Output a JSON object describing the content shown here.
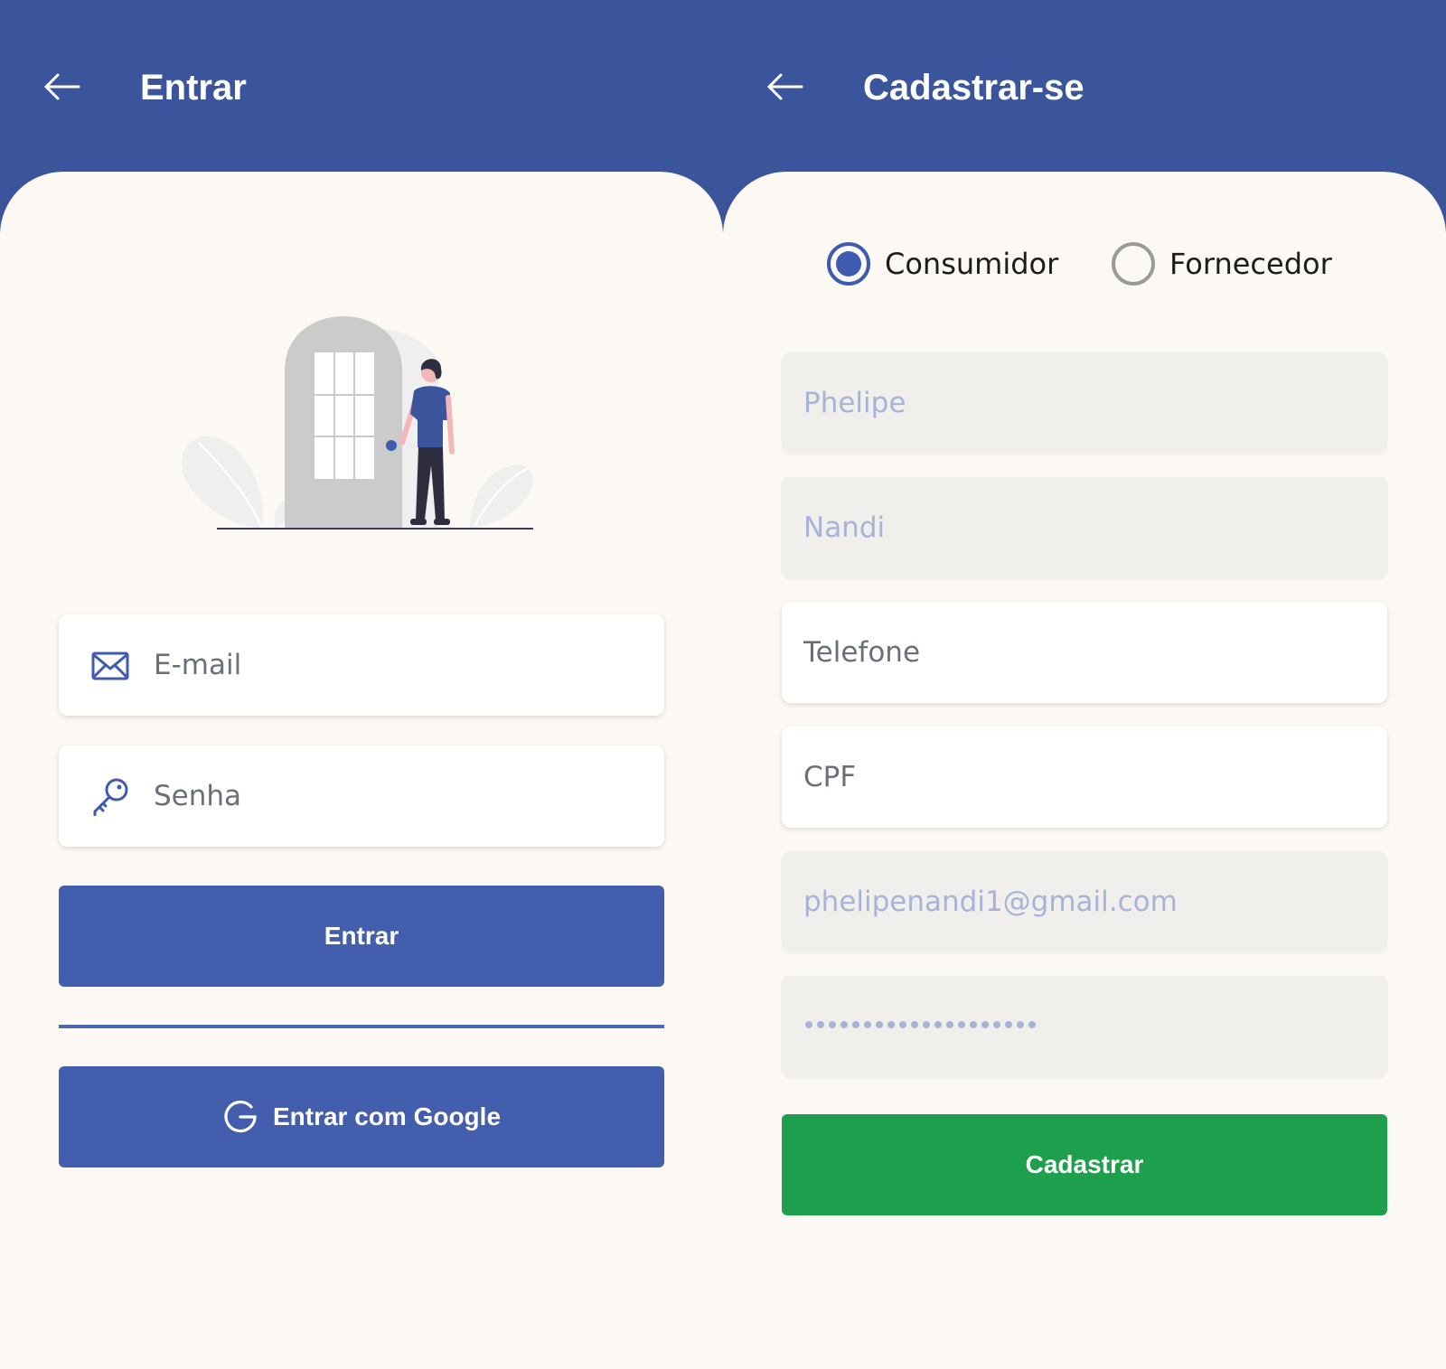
{
  "login": {
    "title": "Entrar",
    "back_icon": "arrow-left-icon",
    "email_placeholder": "E-mail",
    "email_icon": "envelope-icon",
    "password_placeholder": "Senha",
    "password_icon": "key-icon",
    "submit_label": "Entrar",
    "google_label": "Entrar com Google",
    "google_icon": "google-g-icon",
    "illustration": "door-person-illustration"
  },
  "signup": {
    "title": "Cadastrar-se",
    "back_icon": "arrow-left-icon",
    "account_types": [
      {
        "label": "Consumidor",
        "selected": true
      },
      {
        "label": "Fornecedor",
        "selected": false
      }
    ],
    "fields": {
      "first_name": {
        "value": "Phelipe",
        "enabled": false
      },
      "last_name": {
        "value": "Nandi",
        "enabled": false
      },
      "phone": {
        "placeholder": "Telefone",
        "enabled": true
      },
      "cpf": {
        "placeholder": "CPF",
        "enabled": true
      },
      "email": {
        "value": "phelipenandi1@gmail.com",
        "enabled": false
      },
      "password": {
        "masked_length": 20,
        "enabled": false
      }
    },
    "submit_label": "Cadastrar"
  },
  "colors": {
    "header": "#3b559c",
    "background": "#fcf9f4",
    "primary_button": "#435ead",
    "success_button": "#1e9f4d",
    "disabled_field": "#f0efeb",
    "disabled_text": "#a6b4d8"
  }
}
